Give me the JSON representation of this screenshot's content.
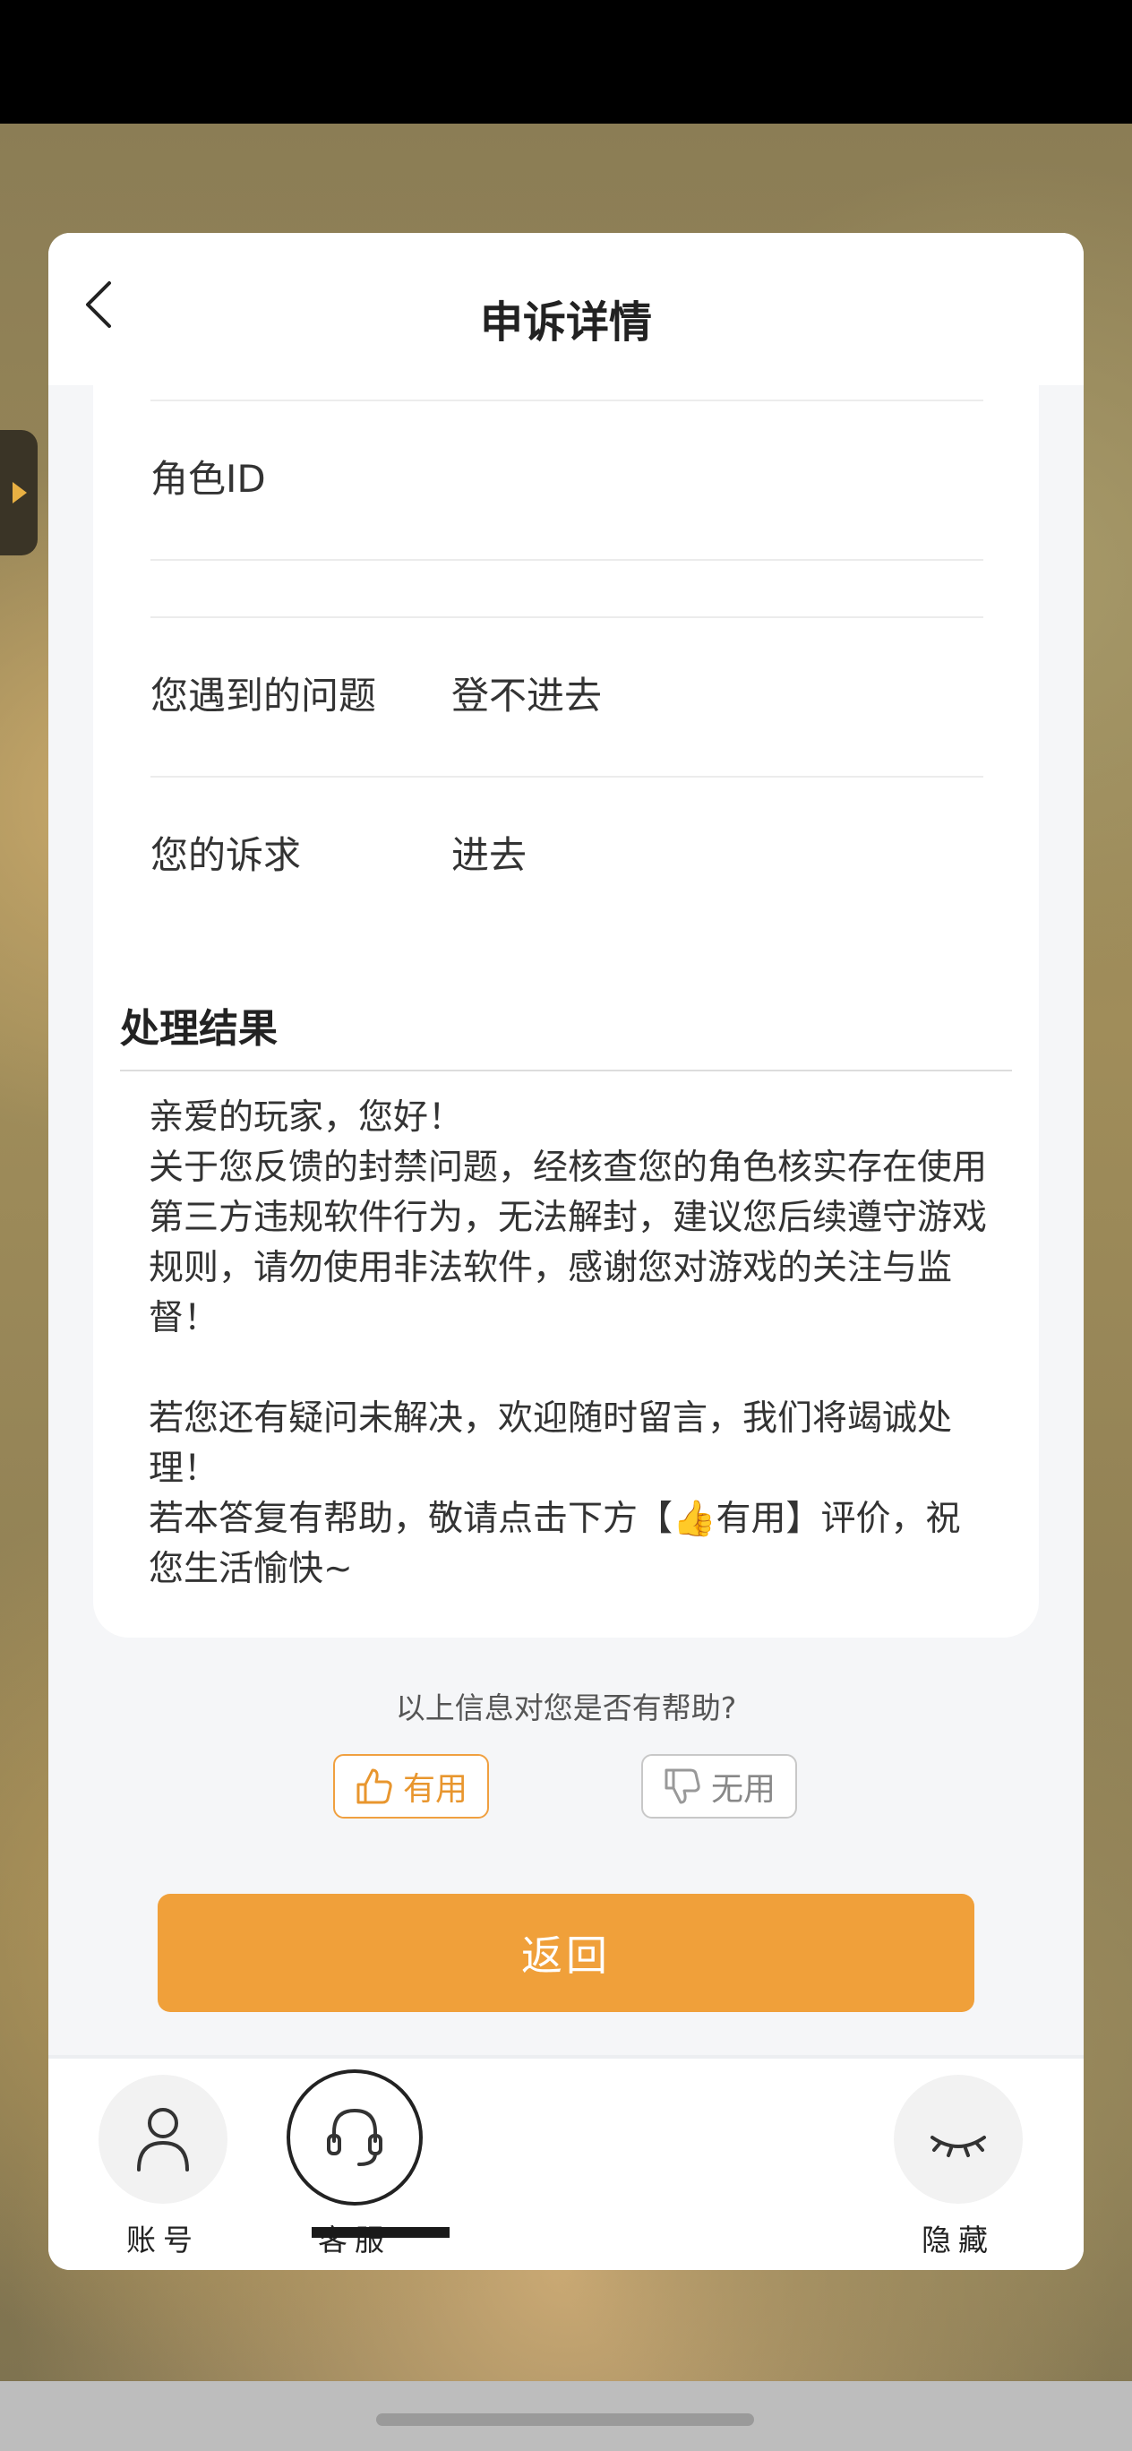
{
  "header": {
    "title": "申诉详情"
  },
  "info": {
    "rows": [
      {
        "label": "角色ID",
        "value": ""
      },
      {
        "label": "",
        "value": ""
      },
      {
        "label": "您遇到的问题",
        "value": "登不进去"
      },
      {
        "label": "您的诉求",
        "value": "进去"
      }
    ]
  },
  "result": {
    "title": "处理结果",
    "text": "亲爱的玩家，您好！\n关于您反馈的封禁问题，经核查您的角色核实存在使用第三方违规软件行为，无法解封，建议您后续遵守游戏规则，请勿使用非法软件，感谢您对游戏的关注与监督！\n\n若您还有疑问未解决，欢迎随时留言，我们将竭诚处理！\n若本答复有帮助，敬请点击下方【👍有用】评价，祝您生活愉快~"
  },
  "feedback": {
    "question": "以上信息对您是否有帮助?",
    "useful_label": "有用",
    "useless_label": "无用"
  },
  "return_label": "返回",
  "tabs": [
    {
      "label": "账号",
      "icon": "person-icon"
    },
    {
      "label": "客服",
      "icon": "headset-icon",
      "active": true
    },
    {
      "label": "隐藏",
      "icon": "closed-eye-icon"
    }
  ],
  "colors": {
    "accent": "#f0a03a",
    "background": "#f5f6f8"
  }
}
